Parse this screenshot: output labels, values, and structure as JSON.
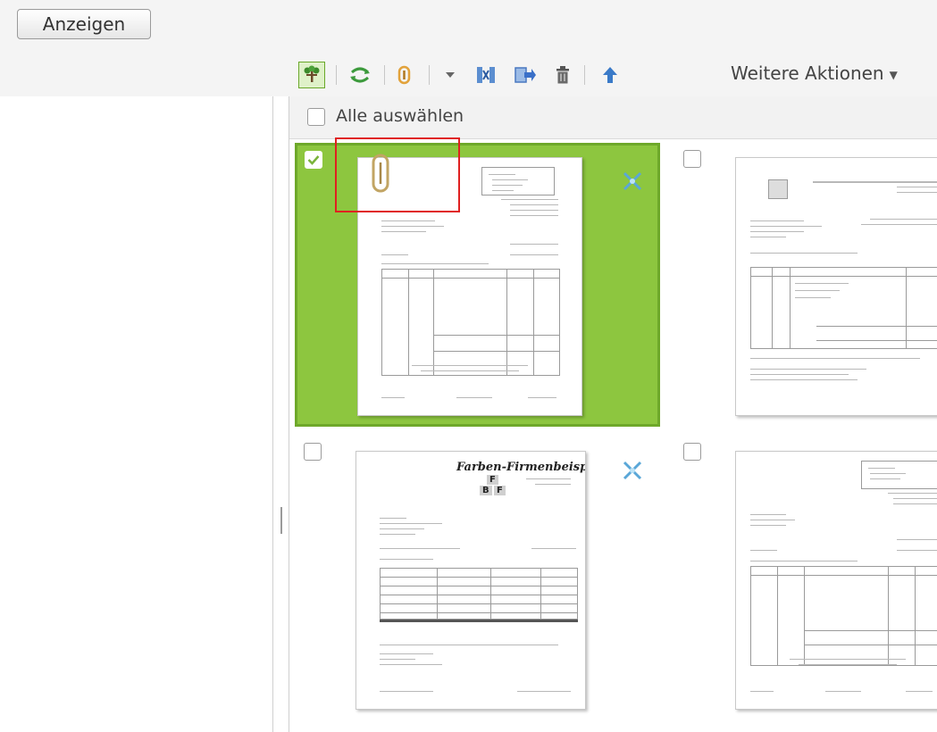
{
  "topbar": {
    "show_button": "Anzeigen"
  },
  "toolbar": {
    "icons": [
      "tree-icon",
      "sync-icon",
      "paperclip-icon",
      "dropdown-arrow-icon",
      "merge-columns-icon",
      "move-icon",
      "trash-icon",
      "arrow-up-icon"
    ],
    "more_actions": "Weitere Aktionen"
  },
  "list": {
    "select_all_label": "Alle auswählen",
    "items": [
      {
        "checked": true,
        "has_attachment": true,
        "pinned": true
      },
      {
        "checked": false,
        "has_attachment": false,
        "pinned": false
      },
      {
        "checked": false,
        "has_attachment": false,
        "pinned": true,
        "header_text": "Farben-Firmenbeispiel",
        "logo_letters": [
          "F",
          "B",
          "F"
        ]
      },
      {
        "checked": false,
        "has_attachment": false,
        "pinned": false
      }
    ]
  },
  "colors": {
    "selected_bg": "#8dc63f",
    "selected_border": "#6ea82a",
    "highlight_box": "#e02020",
    "toolbar_active": "#dff1c8"
  }
}
